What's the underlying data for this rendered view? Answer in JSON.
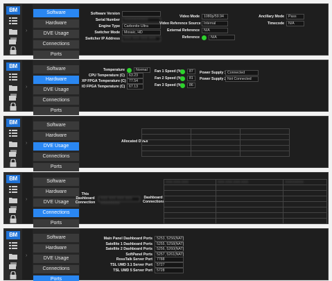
{
  "nav": [
    "Software",
    "Hardware",
    "DVE Usage",
    "Connections",
    "Ports"
  ],
  "logo_text": "BM",
  "accent": "#2a87f2",
  "status_color": "#2dd22d",
  "panel1": {
    "left": [
      {
        "k": "Software Version",
        "v": ""
      },
      {
        "k": "Serial Number",
        "v": "XXXXXXXXXX"
      },
      {
        "k": "Engine Type",
        "v": "Carbonite Ultra"
      },
      {
        "k": "Switcher Mode",
        "v": "Mosaic, HD"
      },
      {
        "k": "Switcher IP Address",
        "v": "XXX.XXX.XXX.XXX"
      }
    ],
    "mid": [
      {
        "k": "Video Mode",
        "v": "1080p/59.94"
      },
      {
        "k": "Video Reference Source",
        "v": "Internal"
      },
      {
        "k": "External Reference",
        "v": "N/A"
      },
      {
        "k": "Reference",
        "v": "N/A"
      }
    ],
    "right": [
      {
        "k": "Ancillary Mode",
        "v": "Pass"
      },
      {
        "k": "Timecode",
        "v": "N/A"
      }
    ]
  },
  "panel2": {
    "left": [
      {
        "k": "Temperature",
        "v": "Normal"
      },
      {
        "k": "CPU Temperature (C)",
        "v": "63.23"
      },
      {
        "k": "XP FPGA Temperature (C)",
        "v": "77.54"
      },
      {
        "k": "IO FPGA Temperature (C)",
        "v": "67.13"
      }
    ],
    "fans": [
      {
        "k": "Fan 1 Speed (%)",
        "v": "87"
      },
      {
        "k": "Fan 2 Speed (%)",
        "v": "81"
      },
      {
        "k": "Fan 3 Speed (%)",
        "v": "86"
      }
    ],
    "psu": [
      {
        "k": "Power Supply 1",
        "v": "Connected"
      },
      {
        "k": "Power Supply 2",
        "v": "Not Connected"
      }
    ]
  },
  "panel3": {
    "label": "Allocated DVEs"
  },
  "panel4": {
    "left_label": "This Dashboard Connection",
    "left_value": "XXX.XXX.XXX.XXX XXXXXXXX",
    "right_label": "Dashboard Connections",
    "header_cells": [
      "XXX.XXX.XXX",
      "XXX.XXX.XXX.XXX",
      "XXXXXXXX"
    ]
  },
  "panel5": [
    {
      "k": "Main Panel Dashboard Ports",
      "v": "5253, 5256(NAT)"
    },
    {
      "k": "Satellite 1 Dashboard Ports",
      "v": "5255, 5258(NAT)"
    },
    {
      "k": "Satellite 2 Dashboard Ports",
      "v": "5256, 5260(NAT)"
    },
    {
      "k": "SoftPanel Ports",
      "v": "5257, 5261(NAT)"
    },
    {
      "k": "RossTalk Server Port",
      "v": "7788"
    },
    {
      "k": "TSL UMD 3.1 Server Port",
      "v": "5727"
    },
    {
      "k": "TSL UMD 5 Server Port",
      "v": "5728"
    }
  ],
  "panels": [
    {
      "active": 0
    },
    {
      "active": 1
    },
    {
      "active": 2
    },
    {
      "active": 3
    },
    {
      "active": 4
    }
  ]
}
